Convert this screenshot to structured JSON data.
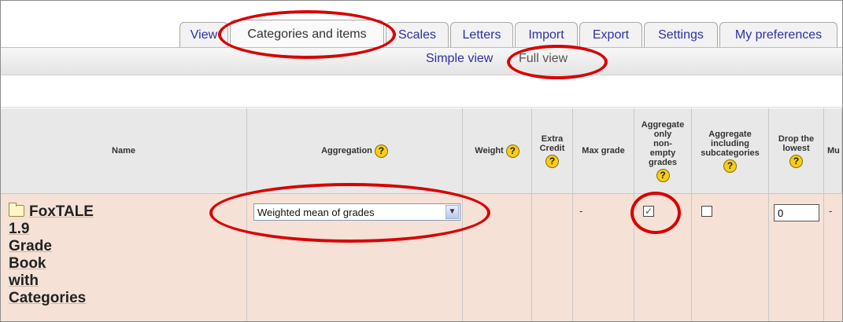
{
  "tabs": [
    {
      "label": "View",
      "active": false
    },
    {
      "label": "Categories and items",
      "active": true
    },
    {
      "label": "Scales",
      "active": false
    },
    {
      "label": "Letters",
      "active": false
    },
    {
      "label": "Import",
      "active": false
    },
    {
      "label": "Export",
      "active": false
    },
    {
      "label": "Settings",
      "active": false
    },
    {
      "label": "My preferences",
      "active": false
    }
  ],
  "subnav": {
    "simple_view": "Simple view",
    "full_view": "Full view"
  },
  "table": {
    "headers": {
      "name": "Name",
      "aggregation": "Aggregation",
      "weight": "Weight",
      "extra_credit": [
        "Extra",
        "Credit"
      ],
      "max_grade": "Max grade",
      "aggregate_non_empty": [
        "Aggregate",
        "only",
        "non-",
        "empty",
        "grades"
      ],
      "aggregate_sub": [
        "Aggregate",
        "including",
        "subcategories"
      ],
      "drop_lowest": [
        "Drop the",
        "lowest"
      ],
      "truncated": "Mu"
    },
    "row": {
      "name_lines": [
        "FoxTALE",
        "1.9",
        "Grade",
        "Book",
        "with",
        "Categories"
      ],
      "aggregation_value": "Weighted mean of grades",
      "max_grade": "-",
      "aggregate_non_empty_checked": true,
      "aggregate_sub_checked": false,
      "drop_lowest_value": "0",
      "truncated_value": "-"
    }
  },
  "help_glyph": "?",
  "check_glyph": "✓",
  "dropdown_glyph": "▼",
  "colors": {
    "highlight_ring": "#d80000",
    "row_bg": "#f5e1d6",
    "help_icon": "#f7cd1a",
    "link": "#2f2fa6"
  }
}
